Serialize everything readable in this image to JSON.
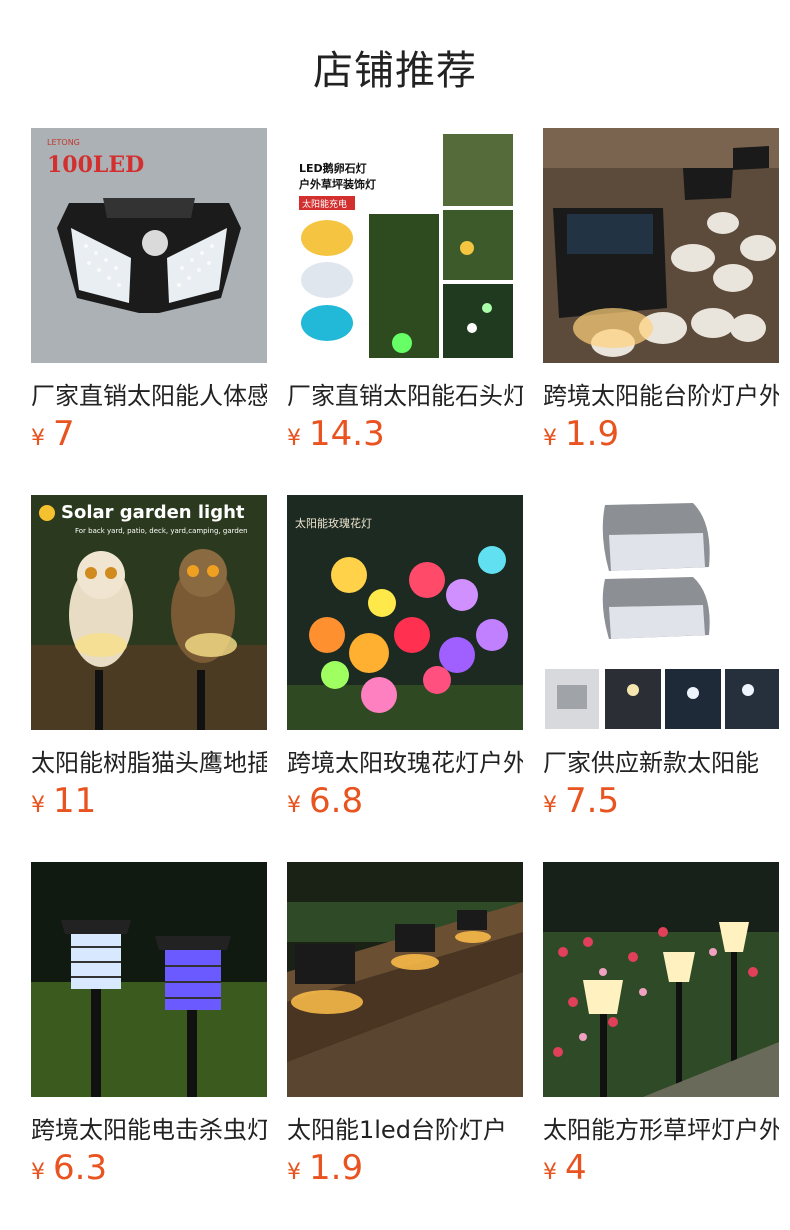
{
  "header": {
    "title": "店铺推荐"
  },
  "currency_symbol": "¥",
  "products": [
    {
      "name": "厂家直销太阳能人体感应灯",
      "price": "7",
      "image_text": [
        "LETONG",
        "100LED"
      ]
    },
    {
      "name": "厂家直销太阳能石头灯",
      "price": "14.3",
      "image_text": [
        "LED鹅卵石灯",
        "户外草坪装饰灯",
        "太阳能充电"
      ]
    },
    {
      "name": "跨境太阳能台阶灯户外",
      "price": "1.9",
      "image_text": []
    },
    {
      "name": "太阳能树脂猫头鹰地插灯",
      "price": "11",
      "image_text": [
        "Solar garden light",
        "For back yard, patio, deck, yard,camping, garden"
      ]
    },
    {
      "name": "跨境太阳玫瑰花灯户外",
      "price": "6.8",
      "image_text": [
        "太阳能玫瑰花灯"
      ]
    },
    {
      "name": "厂家供应新款太阳能",
      "price": "7.5",
      "image_text": []
    },
    {
      "name": "跨境太阳能电击杀虫灯",
      "price": "6.3",
      "image_text": []
    },
    {
      "name": "太阳能1led台阶灯户",
      "price": "1.9",
      "image_text": []
    },
    {
      "name": "太阳能方形草坪灯户外",
      "price": "4",
      "image_text": []
    }
  ]
}
